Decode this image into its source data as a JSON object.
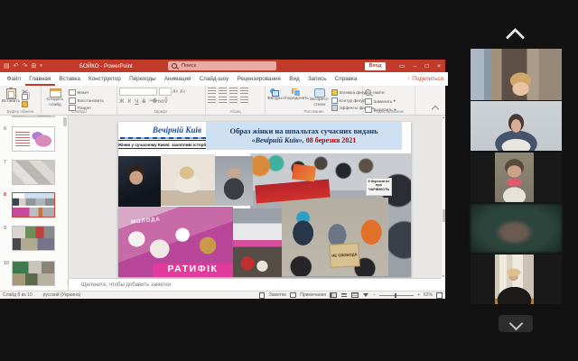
{
  "colors": {
    "ppt_red": "#c23b2a",
    "share_accent": "#c84a35",
    "title_blue": "#17365d",
    "date_red": "#c00000",
    "banner_magenta": "#e23a9d"
  },
  "ppt": {
    "titlebar": {
      "title": "БОЙКО - PowerPoint",
      "search_placeholder": "Поиск",
      "signin": "Вход"
    },
    "tabs": [
      "Файл",
      "Главная",
      "Вставка",
      "Конструктор",
      "Переходы",
      "Анимация",
      "Слайд-шоу",
      "Рецензирование",
      "Вид",
      "Запись",
      "Справка"
    ],
    "active_tab": "Главная",
    "share": "Поделиться",
    "ribbon": {
      "paste": "Вставить",
      "new_slide": "Создать слайд",
      "layout": "Макет",
      "reset": "Восстановить",
      "section": "Раздел",
      "bold": "Ж",
      "italic": "К",
      "underline": "Ч",
      "strike": "S",
      "shapes": "Фигуры",
      "arrange": "Упорядочить",
      "quick_styles": "Экспресс-стили",
      "fill": "Заливка фигуры",
      "outline": "Контур фигуры",
      "effects": "Эффекты фигуры",
      "find": "Найти",
      "replace": "Заменить",
      "select": "Выделить",
      "groups": [
        "Буфер обмена",
        "Слайды",
        "Шрифт",
        "Абзац",
        "Рисование",
        "Редактирование"
      ]
    },
    "slides_panel": {
      "numbers": [
        "6",
        "7",
        "8",
        "9",
        "10"
      ],
      "selected": "8"
    },
    "slide": {
      "masthead_title": "Вечірній Київ",
      "masthead_tagline": "Жінки у сучасному Києві: захопливі історії",
      "title_line1": "Образ жінки на шпальтах сучасних видань",
      "title_name": "«Вечірній Київ»,",
      "title_date": "08 березня 2021",
      "collage": {
        "banner_left": "МОЛОДА",
        "banner_bottom": "РАТИФІК",
        "cardboard_sign": "НЕ СВОБОДА",
        "white_sign": "8 березня не про ЧАРІВНІСТЬ"
      }
    },
    "notes_placeholder": "Щелкните, чтобы добавить заметки",
    "statusbar": {
      "slide_counter": "Слайд 8 из 10",
      "language": "русский (Украина)",
      "notes": "Заметки",
      "comments": "Примечания",
      "zoom": "62%"
    }
  },
  "meeting": {
    "participant_count": 5
  }
}
